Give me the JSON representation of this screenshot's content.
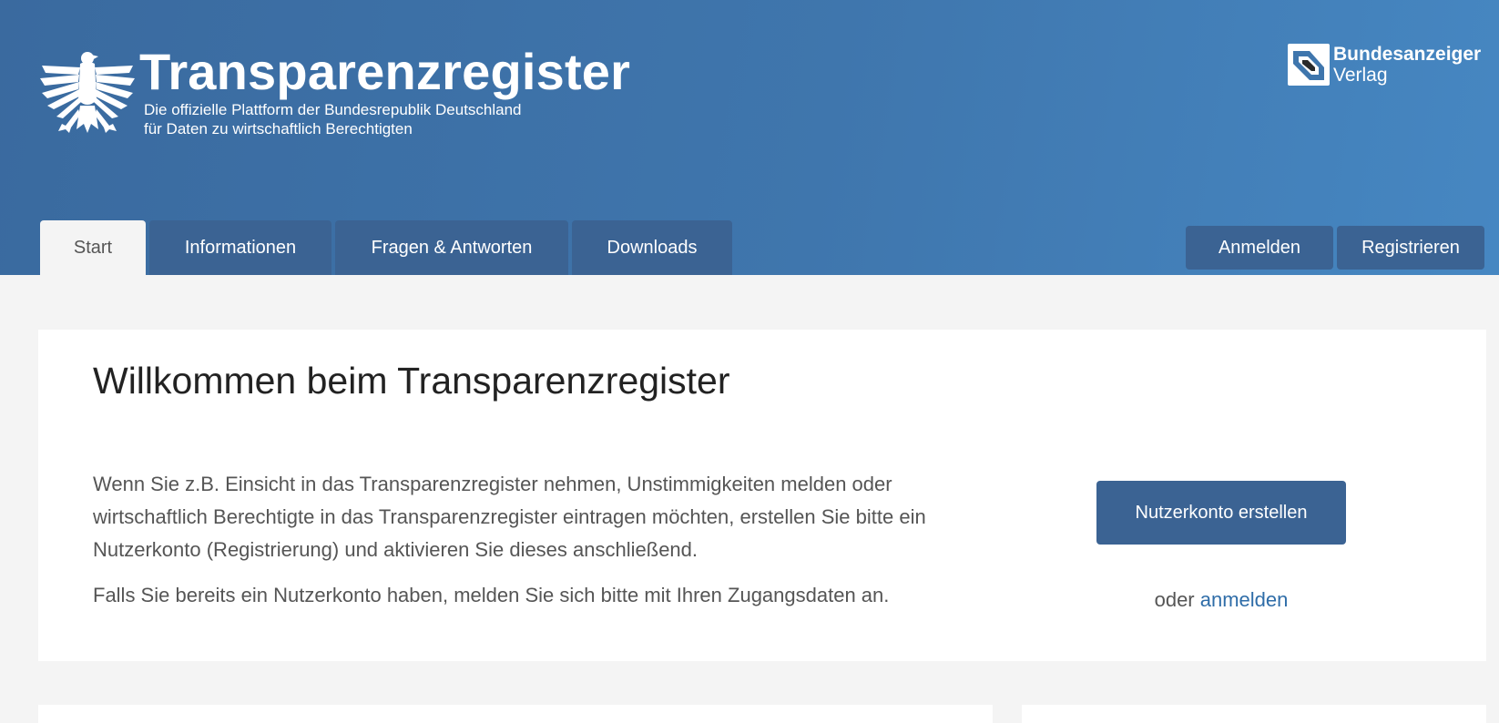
{
  "header": {
    "title": "Transparenzregister",
    "subtitle_line1": "Die offizielle Plattform der Bundesrepublik Deutschland",
    "subtitle_line2": "für Daten zu wirtschaftlich Berechtigten",
    "publisher_name": "Bundesanzeiger",
    "publisher_sub": "Verlag"
  },
  "nav": {
    "tabs": [
      {
        "label": "Start",
        "active": true
      },
      {
        "label": "Informationen",
        "active": false
      },
      {
        "label": "Fragen & Antworten",
        "active": false
      },
      {
        "label": "Downloads",
        "active": false
      }
    ],
    "login_label": "Anmelden",
    "register_label": "Registrieren"
  },
  "welcome": {
    "title": "Willkommen beim Transparenzregister",
    "paragraph1": "Wenn Sie z.B. Einsicht in das Transparenzregister nehmen, Unstimmigkeiten melden oder wirtschaftlich Berechtigte in das Transparenzregister eintragen möchten, erstellen Sie bitte ein Nutzerkonto (Registrierung) und aktivieren Sie dieses anschließend.",
    "paragraph2": "Falls Sie bereits ein Nutzerkonto haben, melden Sie sich bitte mit Ihren Zugangsdaten an.",
    "cta_label": "Nutzerkonto erstellen",
    "or_text": "oder",
    "login_link": "anmelden"
  },
  "icons": {
    "emblem": "federal-eagle-icon",
    "publisher_logo": "bundesanzeiger-logo-icon"
  },
  "colors": {
    "header_start": "#3a6a9f",
    "header_end": "#4687c2",
    "button": "#3b6393",
    "link": "#2f6da8",
    "page_bg": "#f4f4f4"
  }
}
